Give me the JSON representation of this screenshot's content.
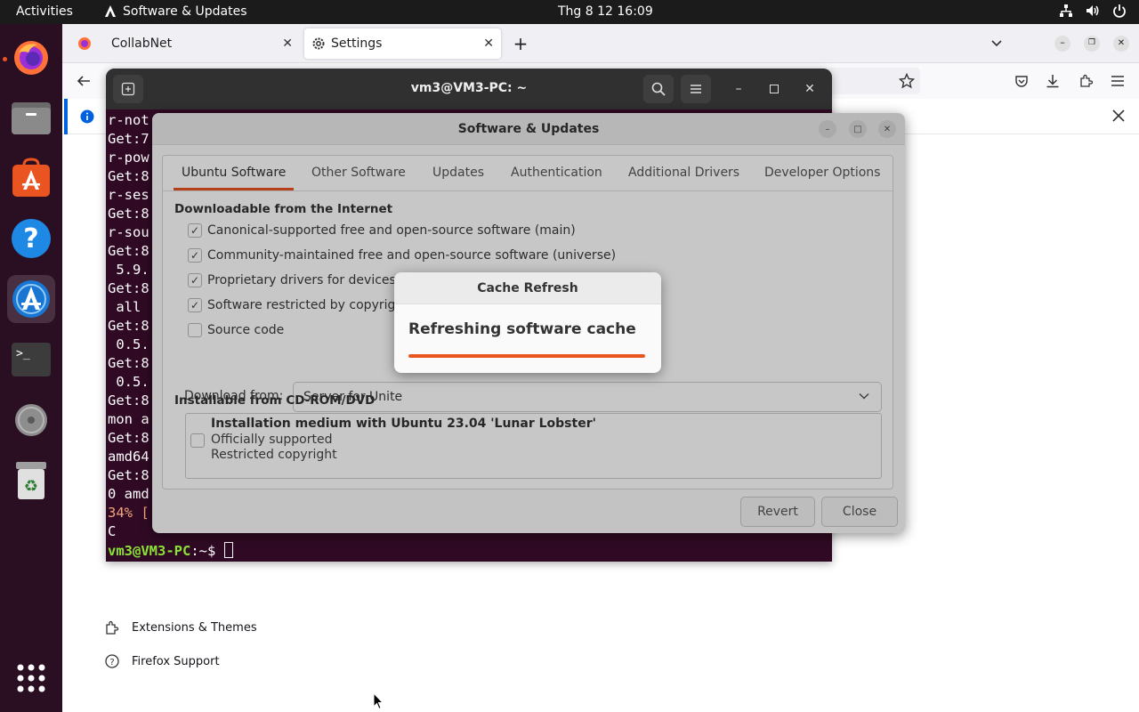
{
  "topbar": {
    "activities": "Activities",
    "app_name": "Software & Updates",
    "clock": "Thg 8 12  16:09",
    "tray_icons": [
      "network-icon",
      "volume-icon",
      "power-icon"
    ]
  },
  "dock": {
    "items": [
      "firefox",
      "files",
      "ubuntu-software",
      "help",
      "software-updater",
      "terminal",
      "disc",
      "trash",
      "show-apps"
    ]
  },
  "browser": {
    "tabs": [
      {
        "label": "CollabNet",
        "active": false
      },
      {
        "label": "Settings",
        "active": true
      }
    ],
    "sidebar_links": [
      {
        "label": "Extensions & Themes",
        "icon": "puzzle-icon"
      },
      {
        "label": "Firefox Support",
        "icon": "help-circle-icon"
      }
    ]
  },
  "terminal": {
    "title": "vm3@VM3-PC: ~",
    "lines": [
      "r-not",
      "Get:7",
      "r-pow",
      "Get:8",
      "r-ses",
      "Get:8",
      "r-sou",
      "Get:8",
      " 5.9.",
      "Get:8",
      " all ",
      "Get:8",
      " 0.5.",
      "Get:8",
      " 0.5.",
      "Get:8",
      "mon a",
      "Get:8",
      "amd64",
      "Get:8",
      "0 amd",
      "34% [",
      "C"
    ],
    "prompt_user": "vm3@VM3-PC",
    "prompt_rest": ":~$ "
  },
  "software_updates": {
    "title": "Software & Updates",
    "tabs": [
      "Ubuntu Software",
      "Other Software",
      "Updates",
      "Authentication",
      "Additional Drivers",
      "Developer Options"
    ],
    "section_internet": "Downloadable from the Internet",
    "checkboxes": [
      {
        "label": "Canonical-supported free and open-source software (main)",
        "checked": true
      },
      {
        "label": "Community-maintained free and open-source software (universe)",
        "checked": true
      },
      {
        "label": "Proprietary drivers for devices (",
        "checked": true
      },
      {
        "label": "Software restricted by copyrigh",
        "checked": true
      },
      {
        "label": "Source code",
        "checked": false
      }
    ],
    "download_from_label": "Download from:",
    "download_from_value": "Server for Unite",
    "section_cdrom": "Installable from CD-ROM/DVD",
    "cdrom": {
      "title": "Installation medium with Ubuntu 23.04 'Lunar Lobster'",
      "line2": "Officially supported",
      "line3": "Restricted copyright"
    },
    "revert_label": "Revert",
    "close_label": "Close"
  },
  "cache_refresh": {
    "title": "Cache Refresh",
    "message": "Refreshing software cache",
    "progress": 1.0,
    "accent": "#e95420"
  }
}
